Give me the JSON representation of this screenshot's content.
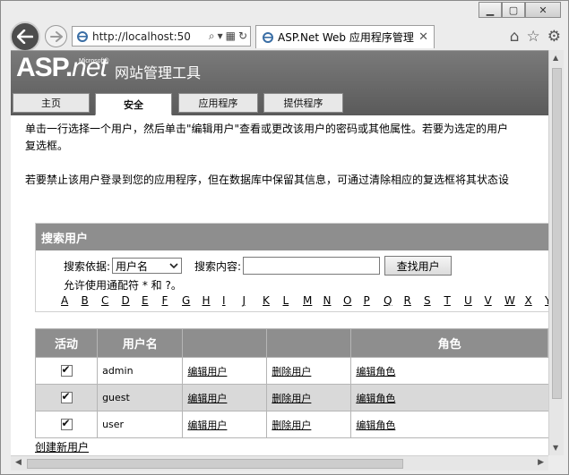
{
  "browser": {
    "url": "http://localhost:50",
    "tab_title": "ASP.Net Web 应用程序管理",
    "tab_close": "✕"
  },
  "header": {
    "logo_main": "ASP",
    "logo_dot": ".",
    "logo_net": "net",
    "logo_super": "Microsoft®",
    "title": "网站管理工具"
  },
  "nav_tabs": [
    "主页",
    "安全",
    "应用程序",
    "提供程序"
  ],
  "intro": {
    "line1": "单击一行选择一个用户，然后单击\"编辑用户\"查看或更改该用户的密码或其他属性。若要为选定的用户",
    "line2": "复选框。",
    "line3": "若要禁止该用户登录到您的应用程序，但在数据库中保留其信息，可通过清除相应的复选框将其状态设"
  },
  "search": {
    "heading": "搜索用户",
    "by_label": "搜索依据:",
    "by_value": "用户名",
    "content_label": "搜索内容:",
    "content_value": "",
    "find_button": "查找用户",
    "wildcard_note": "允许使用通配符 * 和 ?。",
    "letters": [
      "A",
      "B",
      "C",
      "D",
      "E",
      "F",
      "G",
      "H",
      "I",
      "J",
      "K",
      "L",
      "M",
      "N",
      "O",
      "P",
      "Q",
      "R",
      "S",
      "T",
      "U",
      "V",
      "W",
      "X",
      "Y"
    ]
  },
  "table": {
    "headers": [
      "活动",
      "用户名",
      "",
      "",
      "角色"
    ],
    "edit_label": "编辑用户",
    "delete_label": "删除用户",
    "roles_label": "编辑角色",
    "rows": [
      {
        "username": "admin",
        "active": true
      },
      {
        "username": "guest",
        "active": true
      },
      {
        "username": "user",
        "active": true
      }
    ]
  },
  "create_user": "创建新用户"
}
